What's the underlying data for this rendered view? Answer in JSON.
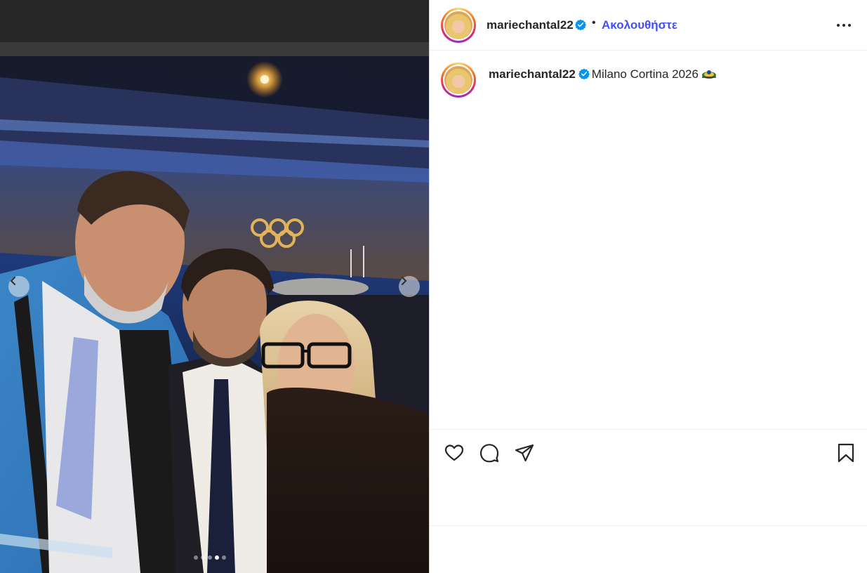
{
  "post": {
    "username": "mariechantal22",
    "verified": true,
    "follow_label": "Ακολουθήστε",
    "bullet": "•",
    "caption": "Milano Cortina 2026",
    "caption_emoji_icon": "sled-emoji-icon"
  },
  "media": {
    "description_icon": "photo",
    "carousel": {
      "count": 5,
      "active_index": 3
    }
  },
  "icons": {
    "more": "more-options-icon",
    "like": "heart-icon",
    "comment": "comment-icon",
    "share": "paper-plane-icon",
    "save": "bookmark-icon",
    "prev": "chevron-left-icon",
    "next": "chevron-right-icon",
    "verified": "verified-badge-icon"
  },
  "colors": {
    "follow": "#4150f7",
    "verified": "#0095f6",
    "text": "#262626",
    "divider": "#efefef"
  }
}
